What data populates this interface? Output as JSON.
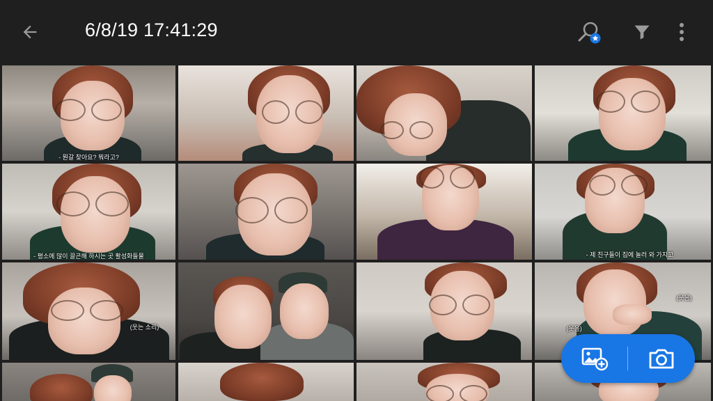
{
  "header": {
    "title": "6/8/19 17:41:29",
    "icons": [
      "back-arrow-icon",
      "smart-search-icon",
      "filter-icon",
      "more-vert-icon"
    ]
  },
  "grid": {
    "captions": {
      "r0c0": "- 뭔갈 찾아요? 뭐라고?",
      "r1c0": "- 평소에 많이 끌곤해 하시는 곳 활성화들물",
      "r1c3": "- 제 친구들이 집에 놀러 와 가지고",
      "r2c0": "(웃는 소리)",
      "r2c3a": "(웃음)",
      "r2c3b": "(웃음)"
    }
  },
  "fab": {
    "add_icon": "add-photo-icon",
    "camera_icon": "camera-icon",
    "color": "#1976e5"
  },
  "colors": {
    "background": "#1f1f1f",
    "accent": "#1976e5"
  }
}
